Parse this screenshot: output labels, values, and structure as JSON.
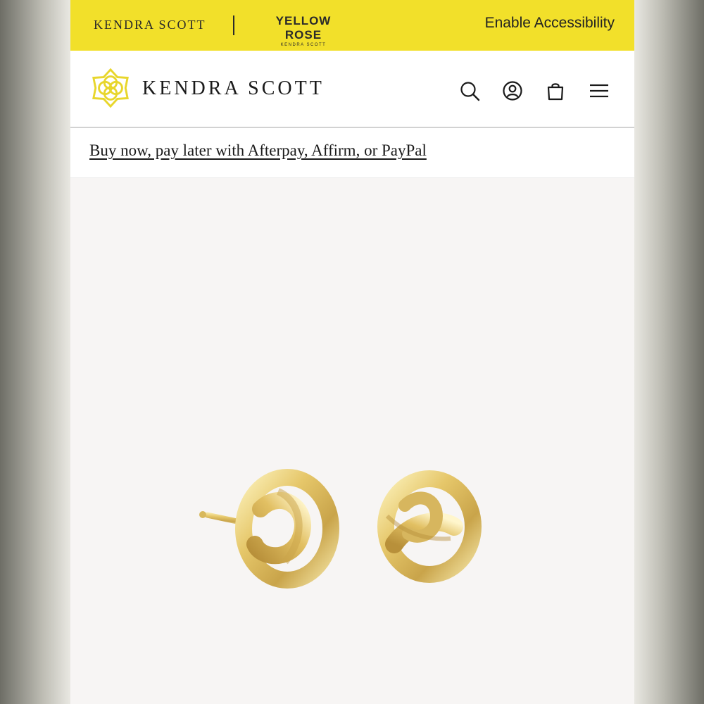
{
  "topbar": {
    "brand": "KENDRA SCOTT",
    "sub_brand": "YELLOW ROSE",
    "sub_brand_caption": "KENDRA SCOTT",
    "accessibility_link": "Enable Accessibility"
  },
  "header": {
    "logo_text": "KENDRA SCOTT",
    "icons": [
      "search-icon",
      "account-icon",
      "bag-icon",
      "menu-icon"
    ]
  },
  "promo": {
    "text": "Buy now, pay later with Afterpay, Affirm, or PayPal"
  },
  "colors": {
    "topbar_bg": "#f2e02a",
    "logo_gold": "#e8d62c",
    "text_dark": "#1a1a1a",
    "product_bg": "#f7f5f4"
  }
}
